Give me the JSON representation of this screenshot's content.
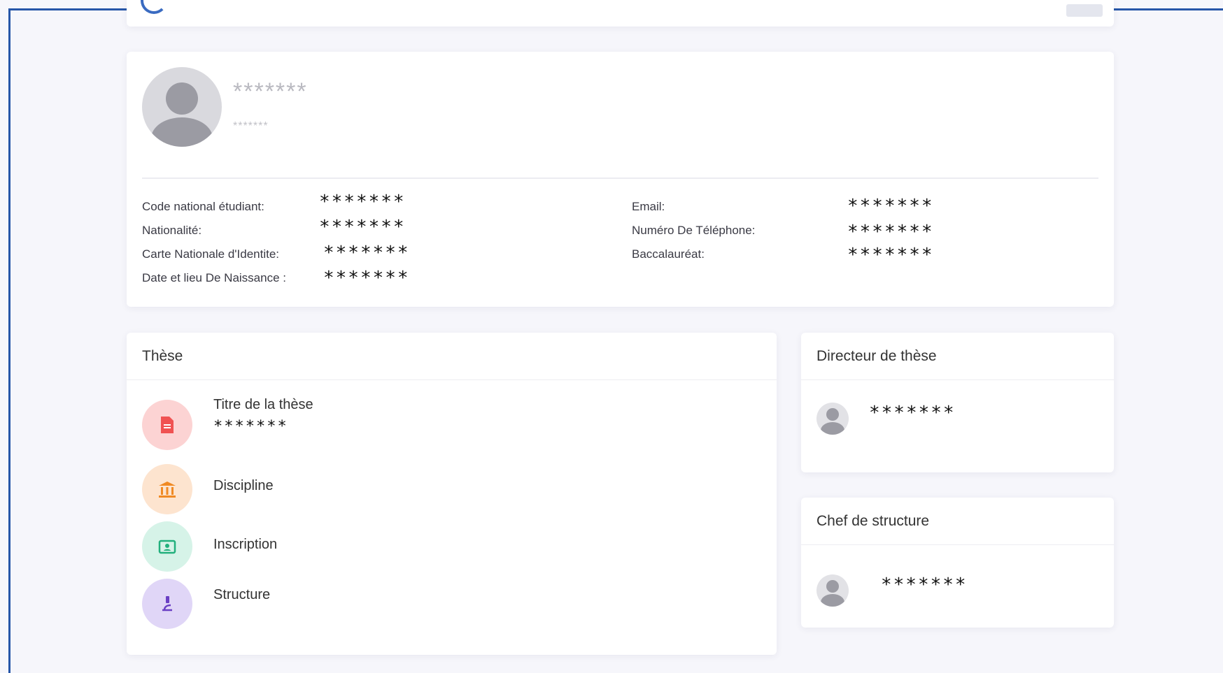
{
  "profile": {
    "name": "*******",
    "subtitle": "*******",
    "fields_left": [
      {
        "label": "Code national étudiant:",
        "value": "*******"
      },
      {
        "label": "Nationalité:",
        "value": "*******"
      },
      {
        "label": "Carte Nationale d'Identite:",
        "value": "*******"
      },
      {
        "label": "Date et lieu De Naissance :",
        "value": "*******"
      }
    ],
    "fields_right": [
      {
        "label": "Email:",
        "value": "*******"
      },
      {
        "label": "Numéro De Téléphone:",
        "value": "*******"
      },
      {
        "label": "Baccalauréat:",
        "value": "*******"
      }
    ]
  },
  "these": {
    "title": "Thèse",
    "items": [
      {
        "label": "Titre de la thèse",
        "value": "*******",
        "icon": "document-icon",
        "color": "#f05252"
      },
      {
        "label": "Discipline",
        "icon": "institution-icon",
        "color": "#f08a24"
      },
      {
        "label": "Inscription",
        "icon": "id-card-icon",
        "color": "#22b07d"
      },
      {
        "label": "Structure",
        "icon": "microscope-icon",
        "color": "#6a3fc4"
      }
    ]
  },
  "directeur": {
    "title": "Directeur de thèse",
    "name": "*******"
  },
  "chef": {
    "title": "Chef de structure",
    "name": "*******"
  }
}
